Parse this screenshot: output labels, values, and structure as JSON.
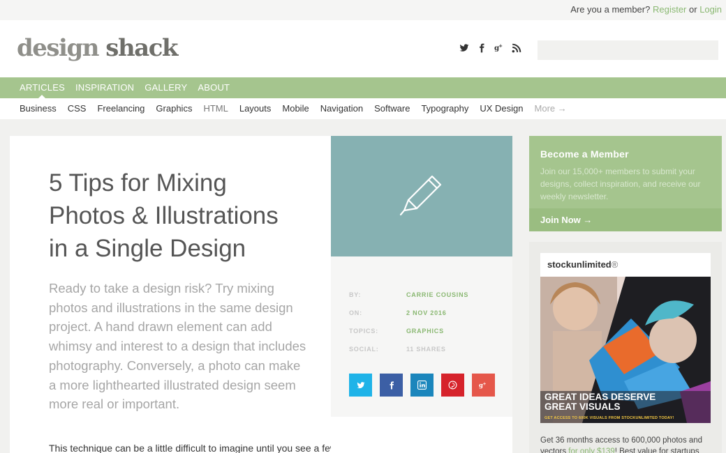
{
  "topbar": {
    "prompt": "Are you a member? ",
    "register": "Register",
    "or": " or ",
    "login": "Login"
  },
  "brand": {
    "logo_part1": "design ",
    "logo_part2": "shack"
  },
  "social_icons": [
    "twitter-icon",
    "facebook-icon",
    "googleplus-icon",
    "rss-icon"
  ],
  "search": {
    "placeholder": ""
  },
  "nav": {
    "items": [
      "ARTICLES",
      "INSPIRATION",
      "GALLERY",
      "ABOUT"
    ],
    "active": "ARTICLES"
  },
  "categories": [
    "Business",
    "CSS",
    "Freelancing",
    "Graphics",
    "HTML",
    "Layouts",
    "Mobile",
    "Navigation",
    "Software",
    "Typography",
    "UX Design",
    "More →"
  ],
  "article": {
    "title": "5 Tips for Mixing Photos & Illustrations in a Single Design",
    "lead": "Ready to take a design risk? Try mixing photos and illustrations in the same design project. A hand drawn element can add whimsy and interest to a design that includes photography. Conversely, a photo can make a more lighthearted illustrated design seem more real or important.",
    "body_start": "This technique can be a little difficult to imagine until you see a few examples of how it"
  },
  "meta": {
    "by_label": "BY:",
    "by": "CARRIE COUSINS",
    "on_label": "ON:",
    "on": "2 NOV 2016",
    "topics_label": "TOPICS:",
    "topics": "GRAPHICS",
    "social_label": "SOCIAL:",
    "social": "11 SHARES"
  },
  "share_buttons": [
    {
      "name": "twitter",
      "glyph": "t",
      "color": "#1fb3e8"
    },
    {
      "name": "facebook",
      "glyph": "f",
      "color": "#3c5fa5"
    },
    {
      "name": "linkedin",
      "glyph": "in",
      "color": "#1b86bc"
    },
    {
      "name": "pinterest",
      "glyph": "P",
      "color": "#d6232b"
    },
    {
      "name": "googleplus",
      "glyph": "g+",
      "color": "#e5574a"
    }
  ],
  "member": {
    "title": "Become a Member",
    "text": "Join our 15,000+ members to submit your designs, collect inspiration, and receive our weekly newsletter.",
    "cta": "Join Now →"
  },
  "ad": {
    "logo_a": "stockunlimited",
    "logo_mark": "®",
    "headline1": "GREAT IDEAS DESERVE",
    "headline2": "GREAT VISUALS",
    "sub": "GET ACCESS TO 600K VISUALS FROM STOCKUNLIMITED TODAY!",
    "caption_pre": "Get 36 months access to 600,000 photos and vectors ",
    "caption_price": "for only $139",
    "caption_post": "! Best value for startups"
  },
  "colors": {
    "accent_green": "#a5c58e",
    "link_green": "#8ab872",
    "hero_teal": "#86b1b2"
  }
}
